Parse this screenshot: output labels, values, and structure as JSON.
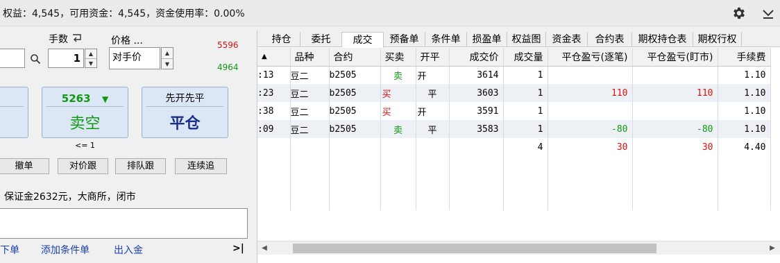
{
  "status": {
    "text": "权益：4,545，可用资金：4,545，资金使用率：0.00%"
  },
  "order_panel": {
    "lots_label": "手数",
    "lots_value": "1",
    "price_label": "价格 ...",
    "price_value": "对手价",
    "ask_price": "5596",
    "bid_price": "4964",
    "sell_short": {
      "price": "5263",
      "arrow": "▼",
      "label": "卖空",
      "note": "<= 1"
    },
    "close_button": {
      "top": "先开先平",
      "label": "平仓"
    },
    "actions": [
      "撤单",
      "对价跟",
      "排队跟",
      "连续追"
    ],
    "info_text": "保证金2632元，大商所，闭市",
    "links": [
      "线下单",
      "添加条件单",
      "出入金"
    ],
    "expand_label": ">|"
  },
  "tabs": {
    "items": [
      "持仓",
      "委托",
      "成交",
      "预备单",
      "条件单",
      "损盈单",
      "权益图",
      "资金表",
      "合约表",
      "期权持仓表",
      "期权行权"
    ],
    "active": "成交"
  },
  "trades_table": {
    "columns": [
      "▲",
      "品种",
      "合约",
      "买卖",
      "开平",
      "成交价",
      "成交量",
      "平仓盈亏(逐笔)",
      "平仓盈亏(盯市)",
      "手续费"
    ],
    "rows": [
      {
        "time": ":13",
        "product": "豆二",
        "contract": "b2505",
        "side": "卖",
        "offset": "开",
        "price": "3614",
        "volume": "1",
        "pnl_trade": "",
        "pnl_mtm": "",
        "fee": "1.10"
      },
      {
        "time": ":23",
        "product": "豆二",
        "contract": "b2505",
        "side": "买",
        "offset": "平",
        "price": "3603",
        "volume": "1",
        "pnl_trade": "110",
        "pnl_mtm": "110",
        "fee": "1.10"
      },
      {
        "time": ":38",
        "product": "豆二",
        "contract": "b2505",
        "side": "买",
        "offset": "开",
        "price": "3591",
        "volume": "1",
        "pnl_trade": "",
        "pnl_mtm": "",
        "fee": "1.10"
      },
      {
        "time": ":09",
        "product": "豆二",
        "contract": "b2505",
        "side": "卖",
        "offset": "平",
        "price": "3583",
        "volume": "1",
        "pnl_trade": "-80",
        "pnl_mtm": "-80",
        "fee": "1.10"
      }
    ],
    "totals": {
      "volume": "4",
      "pnl_trade": "30",
      "pnl_mtm": "30",
      "fee": "4.40"
    }
  },
  "colors": {
    "buy": "#e01010",
    "sell": "#119911",
    "link": "#1a3fb0",
    "button_bg": "#dce7f5"
  },
  "icons": [
    "gear-icon",
    "chevron-down-icon",
    "search-icon",
    "reverse-arrow-icon",
    "spinner-up-icon",
    "spinner-down-icon",
    "expand-right-icon",
    "scroll-left-icon",
    "scroll-right-icon"
  ]
}
